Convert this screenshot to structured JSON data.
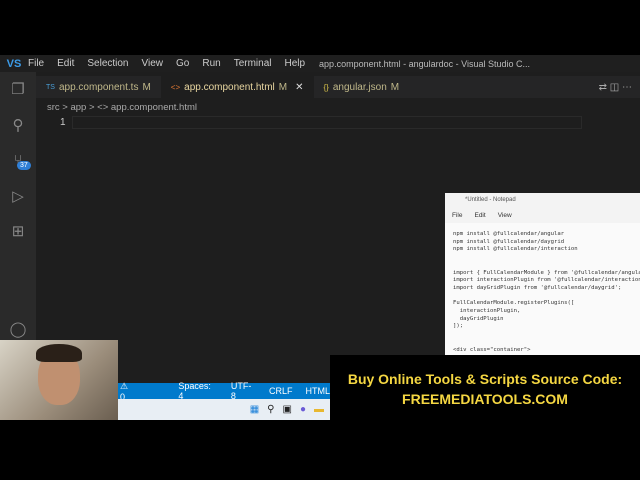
{
  "app": {
    "logo": "VS",
    "menu": [
      "File",
      "Edit",
      "Selection",
      "View",
      "Go",
      "Run",
      "Terminal",
      "Help"
    ],
    "window_title": "app.component.html - angulardoc - Visual Studio C..."
  },
  "activity": {
    "scm_badge": "37"
  },
  "tabs": [
    {
      "icon": "TS",
      "label": "app.component.ts",
      "status": "M"
    },
    {
      "icon": "<>",
      "label": "app.component.html",
      "status": "M",
      "close": "✕"
    },
    {
      "icon": "{}",
      "label": "angular.json",
      "status": "M"
    }
  ],
  "breadcrumb": "src > app > <> app.component.html",
  "editor": {
    "line_number": "1"
  },
  "notepad": {
    "title": "*Untitled - Notepad",
    "menu": [
      "File",
      "Edit",
      "View"
    ],
    "content": "npm install @fullcalendar/angular\nnpm install @fullcalendar/daygrid\nnpm install @fullcalendar/interaction\n\n\nimport { FullCalendarModule } from '@fullcalendar/angular';\nimport interactionPlugin from '@fullcalendar/interaction';\nimport dayGridPlugin from '@fullcalendar/daygrid';\n\nFullCalendarModule.registerPlugins([\n  interactionPlugin,\n  dayGridPlugin\n]);\n\n\n<div class=\"container\">"
  },
  "status": {
    "warnings": "⚠ 0",
    "spaces": "Spaces: 4",
    "encoding": "UTF-8",
    "eol": "CRLF",
    "language": "HTML"
  },
  "banner": {
    "line1": "Buy Online Tools & Scripts Source Code:",
    "line2": "FREEMEDIATOOLS.COM"
  }
}
